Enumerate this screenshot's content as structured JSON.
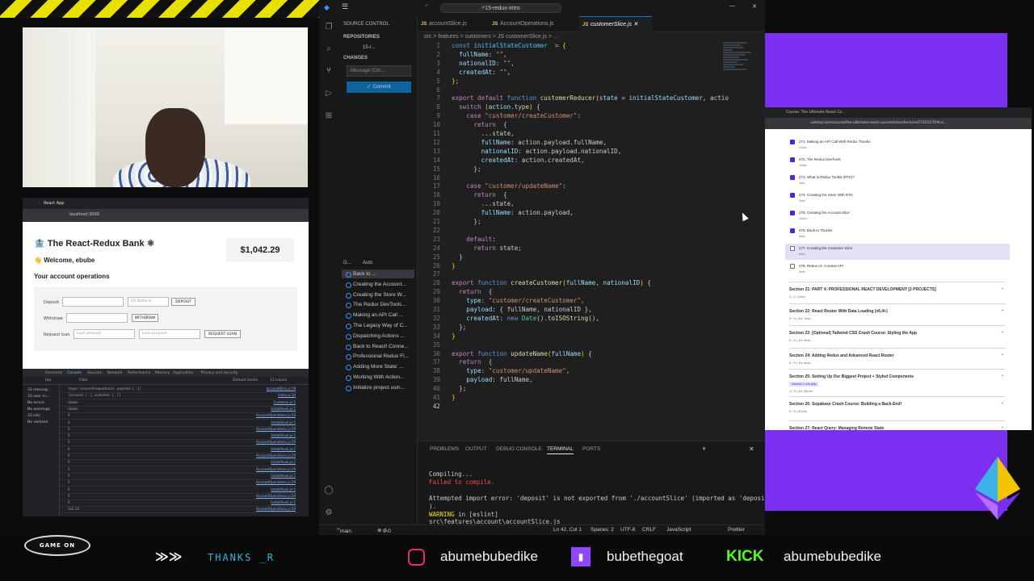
{
  "react_app": {
    "tab_title": "React App",
    "url": "localhost:3000",
    "bank_title": "The React-Redux Bank",
    "welcome": "Welcome, ebube",
    "balance": "$1,042.29",
    "operations_heading": "Your account operations",
    "deposit_label": "Deposit",
    "currency": "US Dollar",
    "deposit_button": "DEPOSIT",
    "withdraw_label": "Withdraw",
    "withdraw_button": "WITHDRAW",
    "request_loan_label": "Request loan",
    "loan_amount_placeholder": "Loan amount",
    "loan_purpose_placeholder": "Loan purpose",
    "request_loan_button": "REQUEST LOAN",
    "devtools_tabs": [
      "Elements",
      "Console",
      "Sources",
      "Network",
      "Performance",
      "Memory",
      "Application",
      "Privacy and security"
    ],
    "devtools_filter": "Filter",
    "devtools_context": "top",
    "devtools_issues": "12 Issues",
    "devtools_levels": "Default levels",
    "console_sidebar": [
      "33 messag...",
      "33 user m...",
      "No errors",
      "No warnings",
      "33 info",
      "No verbose"
    ],
    "log_rows": [
      {
        "text": "{type: 'account/requestLoan', payload: {…}}",
        "src": "accountSlice.js:78"
      },
      {
        "text": "{account: {…}, customer: {…}}",
        "src": "index.js:10"
      },
      {
        "text": "ebube",
        "src": "Customer.js:5"
      },
      {
        "text": "ebube",
        "src": "InstallHook.js:1"
      },
      {
        "text": "0",
        "src": "AccountOperations.js:29"
      },
      {
        "text": "0",
        "src": "InstallHook.js:1"
      },
      {
        "text": "0",
        "src": "AccountOperations.js:29"
      },
      {
        "text": "0",
        "src": "InstallHook.js:1"
      },
      {
        "text": "0",
        "src": "AccountOperations.js:29"
      },
      {
        "text": "0",
        "src": "InstallHook.js:1"
      },
      {
        "text": "0",
        "src": "AccountOperations.js:29"
      },
      {
        "text": "0",
        "src": "InstallHook.js:1"
      },
      {
        "text": "0",
        "src": "AccountOperations.js:29"
      },
      {
        "text": "0",
        "src": "InstallHook.js:1"
      },
      {
        "text": "0",
        "src": "AccountOperations.js:29"
      },
      {
        "text": "0",
        "src": "InstallHook.js:1"
      },
      {
        "text": "0",
        "src": "AccountOperations.js:29"
      },
      {
        "text": "0",
        "src": "InstallHook.js:1"
      },
      {
        "text": "1e2.14",
        "src": "AccountOperations.js:29"
      }
    ]
  },
  "vscode": {
    "search": "15-redux-intro",
    "sidebar": {
      "title": "SOURCE CONTROL",
      "repositories": "REPOSITORIES",
      "repo_name": "15-r...",
      "changes": "CHANGES",
      "message_placeholder": "Message (Ctrl...",
      "commit_button": "Commit",
      "graph_header": "G...",
      "graph_mode": "Auto",
      "branch": "main",
      "commits": [
        "Back to ...",
        "Creating the Account...",
        "Creating the Store W...",
        "The Redux DevTools...",
        "Making an API Call ...",
        "The Legacy Way of C...",
        "Dispatching Actions ...",
        "Back to React! Conne...",
        "Professional Redux Fi...",
        "Adding More State: ...",
        "Working With Action...",
        "Initialize project usin..."
      ]
    },
    "tabs": [
      "accountSlice.js",
      "AccountOperations.js",
      "customerSlice.js"
    ],
    "active_tab": 2,
    "breadcrumb": "src > features > customers > JS customerSlice.js > ...",
    "code_lines": [
      [
        [
          "kb",
          "const "
        ],
        [
          "cn",
          "initialStateCustomer"
        ],
        [
          "",
          "  = "
        ],
        [
          "pn",
          "{"
        ]
      ],
      [
        [
          "vr",
          "  fullName"
        ],
        [
          "",
          ": "
        ],
        [
          "st",
          "\"\""
        ],
        [
          "",
          ","
        ]
      ],
      [
        [
          "vr",
          "  nationalID"
        ],
        [
          "",
          ": "
        ],
        [
          "st",
          "\"\""
        ],
        [
          "",
          ","
        ]
      ],
      [
        [
          "vr",
          "  createdAt"
        ],
        [
          "",
          ": "
        ],
        [
          "st",
          "\"\""
        ],
        [
          "",
          ","
        ]
      ],
      [
        [
          "pn",
          "}"
        ],
        [
          "",
          ";"
        ]
      ],
      [],
      [
        [
          "kw",
          "export default "
        ],
        [
          "kb",
          "function "
        ],
        [
          "fn",
          "customerReducer"
        ],
        [
          "pn",
          "("
        ],
        [
          "vr",
          "state"
        ],
        [
          "",
          " = "
        ],
        [
          "vr",
          "initialStateCustomer"
        ],
        [
          "",
          ", actio"
        ]
      ],
      [
        [
          "kw",
          "  switch "
        ],
        [
          "pn",
          "("
        ],
        [
          "vr",
          "action"
        ],
        [
          "",
          ".type"
        ],
        [
          "pn",
          ")"
        ],
        [
          "",
          " {"
        ]
      ],
      [
        [
          "kw",
          "    case "
        ],
        [
          "st",
          "\"customer/createCustomer\""
        ],
        [
          "",
          ":"
        ]
      ],
      [
        [
          "kw",
          "      return "
        ],
        [
          "",
          " {"
        ]
      ],
      [
        [
          "",
          "        ...state,"
        ]
      ],
      [
        [
          "vr",
          "        fullName"
        ],
        [
          "",
          ": action.payload.fullName,"
        ]
      ],
      [
        [
          "vr",
          "        nationalID"
        ],
        [
          "",
          ": action.payload.nationalID,"
        ]
      ],
      [
        [
          "vr",
          "        createdAt"
        ],
        [
          "",
          ": action.createdAt,"
        ]
      ],
      [
        [
          "",
          "      };"
        ]
      ],
      [],
      [
        [
          "kw",
          "    case "
        ],
        [
          "st",
          "\"customer/updateName\""
        ],
        [
          "",
          ":"
        ]
      ],
      [
        [
          "kw",
          "      return "
        ],
        [
          "",
          " {"
        ]
      ],
      [
        [
          "",
          "        ...state,"
        ]
      ],
      [
        [
          "vr",
          "        fullName"
        ],
        [
          "",
          ": action.payload,"
        ]
      ],
      [
        [
          "",
          "      };"
        ]
      ],
      [],
      [
        [
          "kw",
          "    default"
        ],
        [
          "",
          ":"
        ]
      ],
      [
        [
          "kw",
          "      return "
        ],
        [
          "",
          "state;"
        ]
      ],
      [
        [
          "",
          "  }"
        ]
      ],
      [
        [
          "pn",
          "}"
        ]
      ],
      [],
      [
        [
          "kw",
          "export "
        ],
        [
          "kb",
          "function "
        ],
        [
          "fn",
          "createCustomer"
        ],
        [
          "pn",
          "("
        ],
        [
          "vr",
          "fullName"
        ],
        [
          "",
          ", "
        ],
        [
          "vr",
          "nationalID"
        ],
        [
          "pn",
          ")"
        ],
        [
          "",
          " {"
        ]
      ],
      [
        [
          "kw",
          "  return "
        ],
        [
          "",
          " {"
        ]
      ],
      [
        [
          "vr",
          "    type"
        ],
        [
          "",
          ": "
        ],
        [
          "st",
          "\"customer/createCustomer\""
        ],
        [
          "",
          ","
        ]
      ],
      [
        [
          "vr",
          "    payload"
        ],
        [
          "",
          ": { fullName, nationalID },"
        ]
      ],
      [
        [
          "vr",
          "    createdAt"
        ],
        [
          "",
          ": "
        ],
        [
          "kb",
          "new "
        ],
        [
          "gr",
          "Date"
        ],
        [
          "",
          "()."
        ],
        [
          "fn",
          "toISOString"
        ],
        [
          "",
          "(),"
        ]
      ],
      [
        [
          "",
          "  };"
        ]
      ],
      [
        [
          "pn",
          "}"
        ]
      ],
      [],
      [
        [
          "kw",
          "export "
        ],
        [
          "kb",
          "function "
        ],
        [
          "fn",
          "updateName"
        ],
        [
          "pn",
          "("
        ],
        [
          "vr",
          "fullName"
        ],
        [
          "pn",
          ")"
        ],
        [
          "",
          " {"
        ]
      ],
      [
        [
          "kw",
          "  return "
        ],
        [
          "",
          " {"
        ]
      ],
      [
        [
          "vr",
          "    type"
        ],
        [
          "",
          ": "
        ],
        [
          "st",
          "\"customer/updateName\""
        ],
        [
          "",
          ","
        ]
      ],
      [
        [
          "vr",
          "    payload"
        ],
        [
          "",
          ": fullName,"
        ]
      ],
      [
        [
          "",
          "  };"
        ]
      ],
      [
        [
          "pn",
          "}"
        ]
      ],
      []
    ],
    "panel_tabs": [
      "PROBLEMS",
      "OUTPUT",
      "DEBUG CONSOLE",
      "TERMINAL",
      "PORTS"
    ],
    "active_panel_tab": 3,
    "terminal": {
      "compiling": "Compiling...",
      "failed": "Failed to compile.",
      "error1": "Attempted import error: 'deposit' is not exported from './accountSlice' (imported as 'deposit'",
      "error2": ").",
      "warning_word": "WARNING",
      "warning_rest": " in [eslint]",
      "file": "src\\features\\account\\accountSlice.js"
    },
    "status": {
      "branch": "main",
      "errors": "0",
      "warnings": "0",
      "position": "Ln 42, Col 1",
      "spaces": "Spaces: 2",
      "encoding": "UTF-8",
      "eol": "CRLF",
      "language": "JavaScript",
      "prettier": "Prettier"
    }
  },
  "udemy": {
    "tab_title": "Course: The Ultimate React Co...",
    "url": "udemy.com/course/the-ultimate-react-course/learn/lecture/37351170#co...",
    "lectures": [
      {
        "title": "271. Making an API Call With Redux Thunks",
        "dur": "13min",
        "done": true
      },
      {
        "title": "272. The Redux DevTools",
        "dur": "10min",
        "done": true
      },
      {
        "title": "273. What is Redux Toolkit (RTK)?",
        "dur": "4min",
        "done": true
      },
      {
        "title": "274. Creating the Store With RTK",
        "dur": "5min",
        "done": true
      },
      {
        "title": "275. Creating the Account Slice",
        "dur": "15min",
        "done": true
      },
      {
        "title": "276. Back to Thunks",
        "dur": "5min",
        "done": true
      },
      {
        "title": "277. Creating the Customer Slice",
        "dur": "8min",
        "done": false
      },
      {
        "title": "278. Redux vs. Context API",
        "dur": "6min",
        "done": false
      }
    ],
    "sections": [
      {
        "title": "Section 21: PART 4: PROFESSIONAL REACT DEVELOPMENT [2 PROJECTS]",
        "sub": "0 / 2 | 2min"
      },
      {
        "title": "Section 22: React Router With Data Loading (v6.4+)",
        "sub": "0 / 9 | 2hr 7min"
      },
      {
        "title": "Section 23: [Optional] Tailwind CSS Crash Course: Styling the App",
        "sub": "0 / 8 | 1hr 9min"
      },
      {
        "title": "Section 24: Adding Redux and Advanced React Router",
        "sub": "0 / 9 | 1hr 4min"
      },
      {
        "title": "Section 25: Setting Up Our Biggest Project + Styled Components",
        "sub": "1 / 9 | 1hr 30min",
        "badge": "Includes 1 role play"
      },
      {
        "title": "Section 26: Supabase Crash Course: Building a Back-End!",
        "sub": "0 / 9 | 52min"
      },
      {
        "title": "Section 27: React Query: Managing Remote State",
        "sub": ""
      }
    ]
  },
  "stream": {
    "logo": "GAME ON",
    "thanks": "THANKS  _R",
    "instagram": "abumebubedike",
    "twitch": "bubethegoat",
    "kick_label": "KICK",
    "kick": "abumebubedike"
  },
  "colors": {
    "accent_purple": "#7b2ff0",
    "vscode_blue": "#0078d4",
    "twitch": "#9146ff",
    "kick": "#53fc18"
  }
}
